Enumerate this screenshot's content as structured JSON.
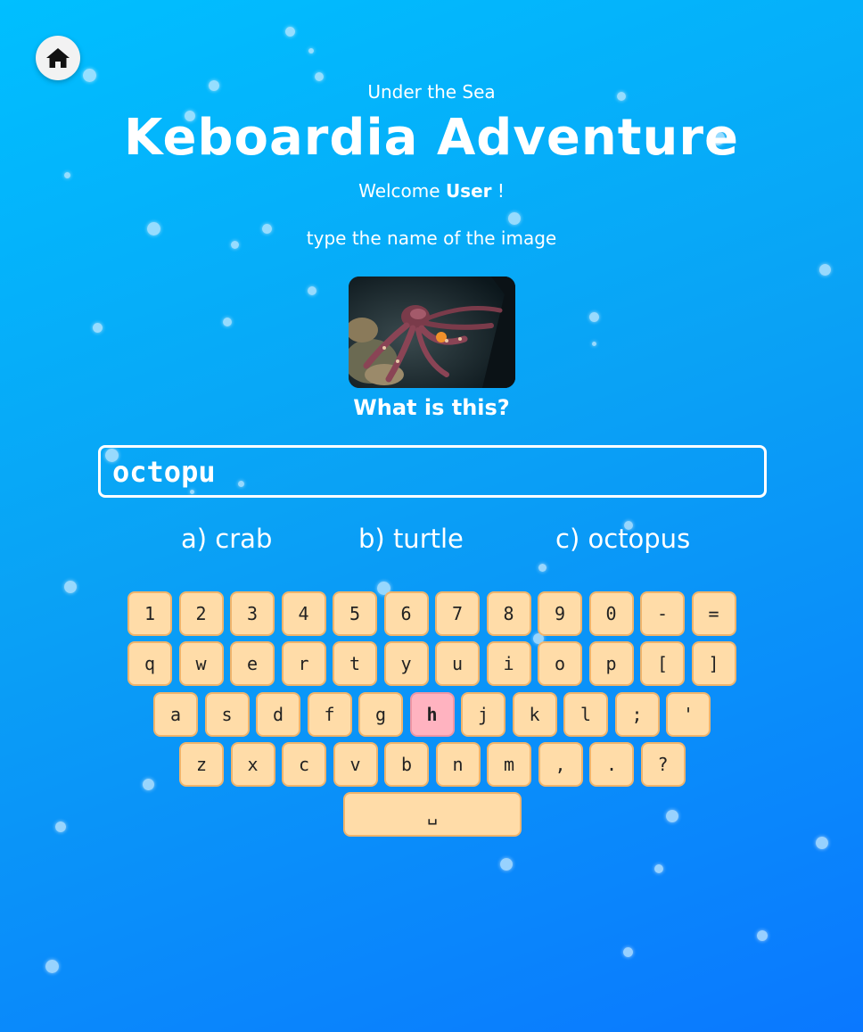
{
  "header": {
    "subtitle": "Under the Sea",
    "title": "Keboardia Adventure",
    "welcome_prefix": "Welcome",
    "username": "User",
    "welcome_suffix": "!",
    "instruction": "type the name of the image"
  },
  "home_button": {
    "icon": "home-icon"
  },
  "image": {
    "subject": "octopus photo"
  },
  "question": "What is this?",
  "input": {
    "value": "octopu"
  },
  "options": [
    {
      "label": "a) crab"
    },
    {
      "label": "b) turtle"
    },
    {
      "label": "c) octopus"
    }
  ],
  "keyboard": {
    "rows": [
      [
        "1",
        "2",
        "3",
        "4",
        "5",
        "6",
        "7",
        "8",
        "9",
        "0",
        "-",
        "="
      ],
      [
        "q",
        "w",
        "e",
        "r",
        "t",
        "y",
        "u",
        "i",
        "o",
        "p",
        "[",
        "]"
      ],
      [
        "a",
        "s",
        "d",
        "f",
        "g",
        "h",
        "j",
        "k",
        "l",
        ";",
        "'"
      ],
      [
        "z",
        "x",
        "c",
        "v",
        "b",
        "n",
        "m",
        ",",
        ".",
        "?"
      ]
    ],
    "space_label": "␣",
    "highlighted_key": "h"
  },
  "colors": {
    "background_top": "#00bfff",
    "background_bottom": "#0a78ff",
    "key_fill": "#ffdca8",
    "key_border": "#f0b46c",
    "key_highlight": "#ffb3c0"
  }
}
